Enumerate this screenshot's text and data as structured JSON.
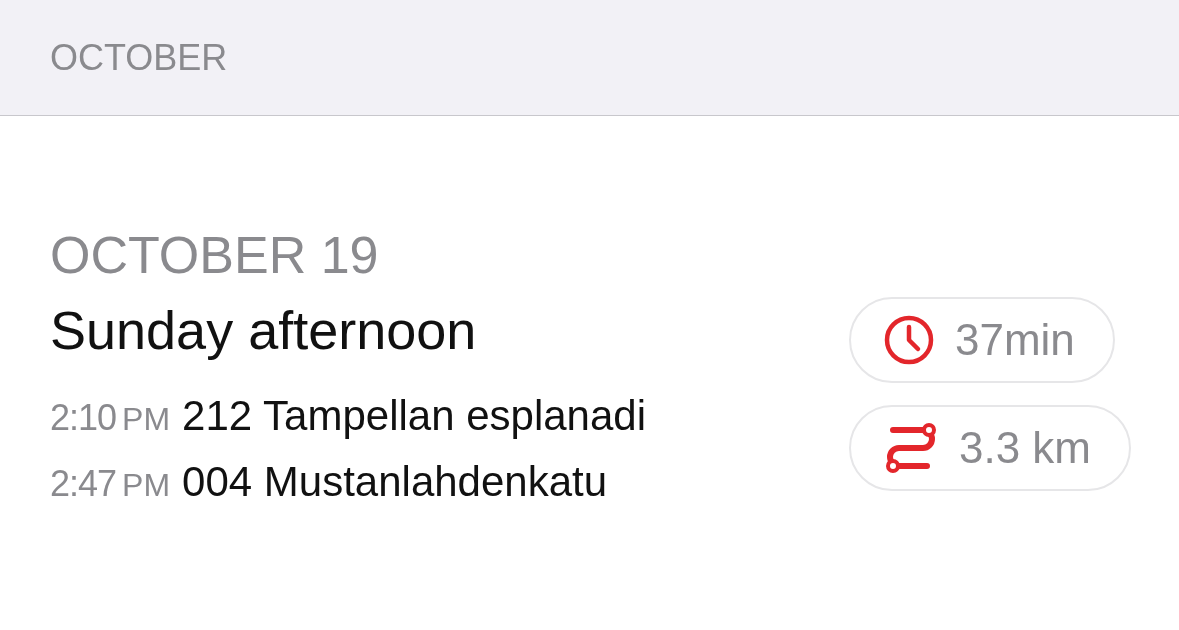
{
  "section_header": "OCTOBER",
  "trip": {
    "date": "OCTOBER 19",
    "title": "Sunday afternoon",
    "stops": [
      {
        "time": "2:10",
        "period": "PM",
        "place": "212 Tampellan esplanadi"
      },
      {
        "time": "2:47",
        "period": "PM",
        "place": "004 Mustanlahdenkatu"
      }
    ],
    "stats": [
      {
        "kind": "duration",
        "value": "37min"
      },
      {
        "kind": "distance",
        "value": "3.3 km"
      }
    ]
  }
}
